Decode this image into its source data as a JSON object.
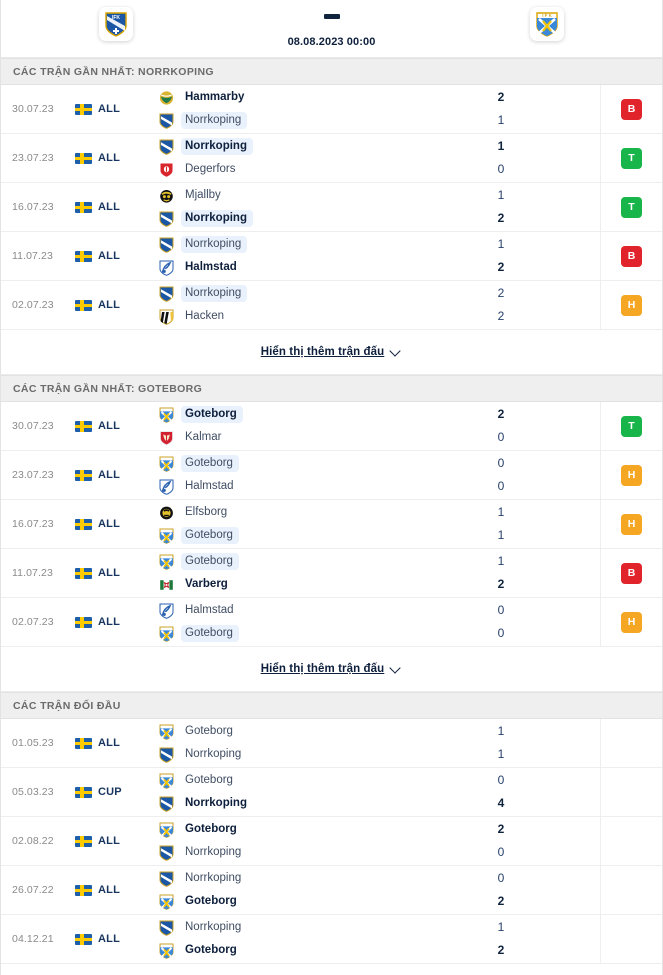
{
  "header": {
    "home_team": "Norrkoping",
    "away_team": "Goteborg",
    "home_crest": "norrkoping-crest",
    "away_crest": "goteborg-crest",
    "separator": "-",
    "kickoff": "08.08.2023 00:00"
  },
  "sections": [
    {
      "id": "recent-norrkoping",
      "title": "CÁC TRẬN GẦN NHẤT: NORRKOPING",
      "show_more_label": "Hiển thị thêm trận đấu",
      "matches": [
        {
          "date": "30.07.23",
          "country": "Sweden",
          "competition": "ALL",
          "home": {
            "name": "Hammarby",
            "crest": "hammarby-crest",
            "score": "2",
            "winner": true,
            "highlight": false
          },
          "away": {
            "name": "Norrkoping",
            "crest": "norrkoping-crest",
            "score": "1",
            "winner": false,
            "highlight": true
          },
          "result": "B"
        },
        {
          "date": "23.07.23",
          "country": "Sweden",
          "competition": "ALL",
          "home": {
            "name": "Norrkoping",
            "crest": "norrkoping-crest",
            "score": "1",
            "winner": true,
            "highlight": true
          },
          "away": {
            "name": "Degerfors",
            "crest": "degerfors-crest",
            "score": "0",
            "winner": false,
            "highlight": false
          },
          "result": "T"
        },
        {
          "date": "16.07.23",
          "country": "Sweden",
          "competition": "ALL",
          "home": {
            "name": "Mjallby",
            "crest": "mjallby-crest",
            "score": "1",
            "winner": false,
            "highlight": false
          },
          "away": {
            "name": "Norrkoping",
            "crest": "norrkoping-crest",
            "score": "2",
            "winner": true,
            "highlight": true
          },
          "result": "T"
        },
        {
          "date": "11.07.23",
          "country": "Sweden",
          "competition": "ALL",
          "home": {
            "name": "Norrkoping",
            "crest": "norrkoping-crest",
            "score": "1",
            "winner": false,
            "highlight": true
          },
          "away": {
            "name": "Halmstad",
            "crest": "halmstad-crest",
            "score": "2",
            "winner": true,
            "highlight": false
          },
          "result": "B"
        },
        {
          "date": "02.07.23",
          "country": "Sweden",
          "competition": "ALL",
          "home": {
            "name": "Norrkoping",
            "crest": "norrkoping-crest",
            "score": "2",
            "winner": false,
            "highlight": true
          },
          "away": {
            "name": "Hacken",
            "crest": "hacken-crest",
            "score": "2",
            "winner": false,
            "highlight": false
          },
          "result": "H"
        }
      ]
    },
    {
      "id": "recent-goteborg",
      "title": "CÁC TRẬN GẦN NHẤT: GOTEBORG",
      "show_more_label": "Hiển thị thêm trận đấu",
      "matches": [
        {
          "date": "30.07.23",
          "country": "Sweden",
          "competition": "ALL",
          "home": {
            "name": "Goteborg",
            "crest": "goteborg-crest",
            "score": "2",
            "winner": true,
            "highlight": true
          },
          "away": {
            "name": "Kalmar",
            "crest": "kalmar-crest",
            "score": "0",
            "winner": false,
            "highlight": false
          },
          "result": "T"
        },
        {
          "date": "23.07.23",
          "country": "Sweden",
          "competition": "ALL",
          "home": {
            "name": "Goteborg",
            "crest": "goteborg-crest",
            "score": "0",
            "winner": false,
            "highlight": true
          },
          "away": {
            "name": "Halmstad",
            "crest": "halmstad-crest",
            "score": "0",
            "winner": false,
            "highlight": false
          },
          "result": "H"
        },
        {
          "date": "16.07.23",
          "country": "Sweden",
          "competition": "ALL",
          "home": {
            "name": "Elfsborg",
            "crest": "elfsborg-crest",
            "score": "1",
            "winner": false,
            "highlight": false
          },
          "away": {
            "name": "Goteborg",
            "crest": "goteborg-crest",
            "score": "1",
            "winner": false,
            "highlight": true
          },
          "result": "H"
        },
        {
          "date": "11.07.23",
          "country": "Sweden",
          "competition": "ALL",
          "home": {
            "name": "Goteborg",
            "crest": "goteborg-crest",
            "score": "1",
            "winner": false,
            "highlight": true
          },
          "away": {
            "name": "Varberg",
            "crest": "varberg-crest",
            "score": "2",
            "winner": true,
            "highlight": false
          },
          "result": "B"
        },
        {
          "date": "02.07.23",
          "country": "Sweden",
          "competition": "ALL",
          "home": {
            "name": "Halmstad",
            "crest": "halmstad-crest",
            "score": "0",
            "winner": false,
            "highlight": false
          },
          "away": {
            "name": "Goteborg",
            "crest": "goteborg-crest",
            "score": "0",
            "winner": false,
            "highlight": true
          },
          "result": "H"
        }
      ]
    },
    {
      "id": "head-to-head",
      "title": "CÁC TRẬN ĐỐI ĐẦU",
      "show_more_label": null,
      "matches": [
        {
          "date": "01.05.23",
          "country": "Sweden",
          "competition": "ALL",
          "home": {
            "name": "Goteborg",
            "crest": "goteborg-crest",
            "score": "1",
            "winner": false,
            "highlight": false
          },
          "away": {
            "name": "Norrkoping",
            "crest": "norrkoping-crest",
            "score": "1",
            "winner": false,
            "highlight": false
          },
          "result": null
        },
        {
          "date": "05.03.23",
          "country": "Sweden",
          "competition": "CUP",
          "home": {
            "name": "Goteborg",
            "crest": "goteborg-crest",
            "score": "0",
            "winner": false,
            "highlight": false
          },
          "away": {
            "name": "Norrkoping",
            "crest": "norrkoping-crest",
            "score": "4",
            "winner": true,
            "highlight": false
          },
          "result": null
        },
        {
          "date": "02.08.22",
          "country": "Sweden",
          "competition": "ALL",
          "home": {
            "name": "Goteborg",
            "crest": "goteborg-crest",
            "score": "2",
            "winner": true,
            "highlight": false
          },
          "away": {
            "name": "Norrkoping",
            "crest": "norrkoping-crest",
            "score": "0",
            "winner": false,
            "highlight": false
          },
          "result": null
        },
        {
          "date": "26.07.22",
          "country": "Sweden",
          "competition": "ALL",
          "home": {
            "name": "Norrkoping",
            "crest": "norrkoping-crest",
            "score": "0",
            "winner": false,
            "highlight": false
          },
          "away": {
            "name": "Goteborg",
            "crest": "goteborg-crest",
            "score": "2",
            "winner": true,
            "highlight": false
          },
          "result": null
        },
        {
          "date": "04.12.21",
          "country": "Sweden",
          "competition": "ALL",
          "home": {
            "name": "Norrkoping",
            "crest": "norrkoping-crest",
            "score": "1",
            "winner": false,
            "highlight": false
          },
          "away": {
            "name": "Goteborg",
            "crest": "goteborg-crest",
            "score": "2",
            "winner": true,
            "highlight": false
          },
          "result": null
        }
      ]
    }
  ],
  "colors": {
    "loss_badge": "#e1232b",
    "win_badge": "#18b54a",
    "draw_badge": "#f5a623",
    "highlight_bg": "#e9f1fc",
    "section_bar_bg": "#efefef",
    "flag_blue": "#1d5fa8",
    "flag_yellow": "#fecb00"
  }
}
